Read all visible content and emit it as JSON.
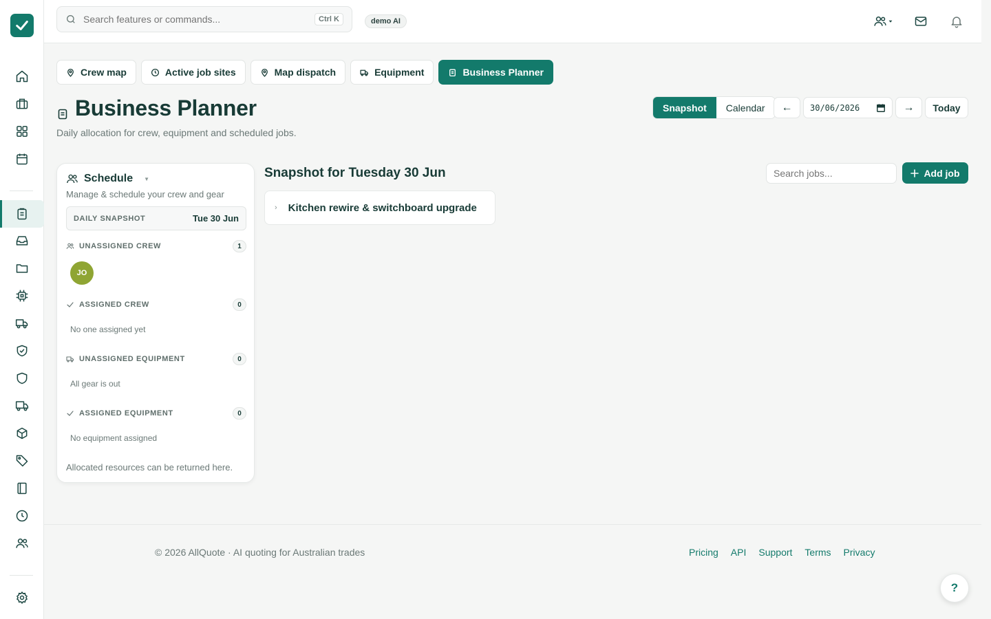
{
  "sidebar": {
    "logo": "check-logo",
    "items": [
      {
        "icon": "home-icon"
      },
      {
        "icon": "briefcase-icon"
      },
      {
        "icon": "grid-icon"
      },
      {
        "icon": "calendar-icon"
      },
      {
        "icon": "clipboard-icon",
        "active": true
      },
      {
        "icon": "inbox-icon"
      },
      {
        "icon": "folder-icon"
      },
      {
        "icon": "chip-icon"
      },
      {
        "icon": "truck-icon"
      },
      {
        "icon": "shield-check-icon"
      },
      {
        "icon": "shield-icon"
      },
      {
        "icon": "truck-delivery-icon"
      },
      {
        "icon": "box-icon"
      },
      {
        "icon": "tag-icon"
      },
      {
        "icon": "book-icon"
      },
      {
        "icon": "clock-icon"
      },
      {
        "icon": "users-icon"
      },
      {
        "icon": "settings-icon"
      }
    ]
  },
  "topbar": {
    "search_placeholder": "Search features or commands...",
    "shortcut": "Ctrl K",
    "badge": "demo AI"
  },
  "tabs": [
    {
      "label": "Crew map",
      "icon": "map-pin-icon",
      "active": false
    },
    {
      "label": "Active job sites",
      "icon": "clock-icon",
      "active": false
    },
    {
      "label": "Map dispatch",
      "icon": "map-pin-icon",
      "active": false
    },
    {
      "label": "Equipment",
      "icon": "truck-icon",
      "active": false
    },
    {
      "label": "Business Planner",
      "icon": "clipboard-icon",
      "active": true
    }
  ],
  "page": {
    "title": "Business Planner",
    "subtitle": "Daily allocation for crew, equipment and scheduled jobs."
  },
  "view_toggle": {
    "snapshot": "Snapshot",
    "calendar": "Calendar",
    "active": "Snapshot"
  },
  "date_nav": {
    "prev": "←",
    "date": "30/06/2026",
    "next": "→",
    "today": "Today"
  },
  "schedule": {
    "title": "Schedule",
    "subtitle": "Manage & schedule your crew and gear",
    "snapshot_label": "DAILY SNAPSHOT",
    "snapshot_date": "Tue 30 Jun",
    "unassigned_crew": {
      "label": "UNASSIGNED CREW",
      "count": "1",
      "avatar": "JO"
    },
    "assigned_crew": {
      "label": "ASSIGNED CREW",
      "count": "0",
      "empty": "No one assigned yet"
    },
    "unassigned_equipment": {
      "label": "UNASSIGNED EQUIPMENT",
      "count": "0",
      "empty": "All gear is out"
    },
    "assigned_equipment": {
      "label": "ASSIGNED EQUIPMENT",
      "count": "0",
      "empty": "No equipment assigned"
    },
    "footer": "Allocated resources can be returned here."
  },
  "main": {
    "heading": "Snapshot for Tuesday 30 Jun",
    "search_placeholder": "Search jobs...",
    "add_job": "Add job",
    "jobs": [
      {
        "title": "Kitchen rewire & switchboard upgrade"
      }
    ]
  },
  "footer": {
    "copyright": "© 2026 AllQuote · AI quoting for Australian trades",
    "links": [
      "Pricing",
      "API",
      "Support",
      "Terms",
      "Privacy"
    ]
  },
  "help": "?",
  "colors": {
    "accent": "#137a6b",
    "text": "#183b36",
    "avatar": "#8fa533"
  }
}
